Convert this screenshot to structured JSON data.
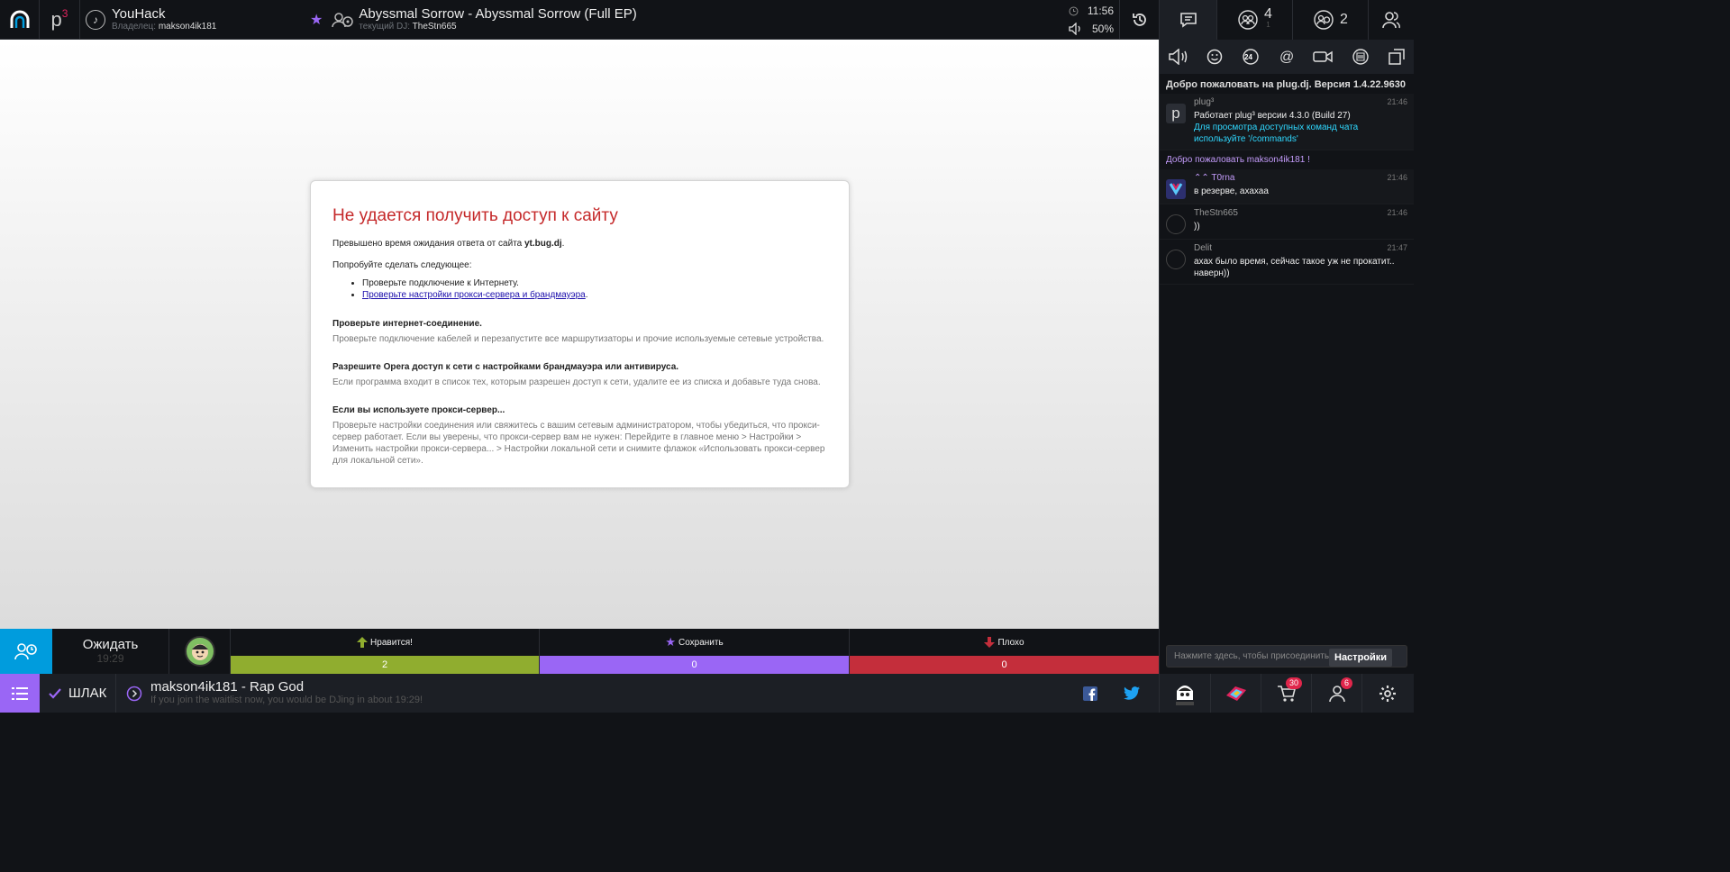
{
  "topbar": {
    "logo_sup": "3",
    "logo_p": "p",
    "room_name": "YouHack",
    "owner_label": "Владелец:",
    "owner_name": "makson4ik181",
    "song_title": "Abyssmal Sorrow - Abyssmal Sorrow (Full EP)",
    "dj_label": "текущий DJ:",
    "dj_name": "TheStn665",
    "time": "11:56",
    "volume": "50%"
  },
  "error_page": {
    "title": "Не удается получить доступ к сайту",
    "timeout_prefix": "Превышено время ожидания ответа от сайта ",
    "timeout_host": "yt.bug.dj",
    "timeout_suffix": ".",
    "try_label": "Попробуйте сделать следующее:",
    "suggestions": [
      "Проверьте подключение к Интернету.",
      "Проверьте настройки прокси-сервера и брандмауэра"
    ],
    "sections": [
      {
        "heading": "Проверьте интернет-соединение.",
        "text": "Проверьте подключение кабелей и перезапустите все маршрутизаторы и прочие используемые сетевые устройства."
      },
      {
        "heading": "Разрешите Opera доступ к сети с настройками брандмауэра или антивируса.",
        "text": "Если программа входит в список тех, которым разрешен доступ к сети, удалите ее из списка и добавьте туда снова."
      },
      {
        "heading": "Если вы используете прокси-сервер...",
        "text": "Проверьте настройки соединения или свяжитесь с вашим сетевым администратором, чтобы убедиться, что прокси-сервер работает. Если вы уверены, что прокси-сервер вам не нужен: Перейдите в главное меню > Настройки > Изменить настройки прокси-сервера... > Настройки локальной сети и снимите флажок «Использовать прокси-сервер для локальной сети»."
      }
    ]
  },
  "bottom": {
    "wait_label": "Ожидать",
    "wait_time": "19:29",
    "votes": [
      {
        "label": "Нравится!",
        "count": "2",
        "color": "#90ad2f",
        "icon": "arrow-up-icon"
      },
      {
        "label": "Сохранить",
        "count": "0",
        "color": "#9a66f5",
        "icon": "star-icon"
      },
      {
        "label": "Плохо",
        "count": "0",
        "color": "#c42e3b",
        "icon": "arrow-down-icon"
      }
    ]
  },
  "footer": {
    "playlist_name": "ШЛАК",
    "next_song": "makson4ik181 - Rap God",
    "next_hint": "If you join the waitlist now, you would be DJing in about 19:29!"
  },
  "sidebar": {
    "tabs": [
      {
        "name": "chat",
        "icon": "chat-icon",
        "count": ""
      },
      {
        "name": "audience",
        "icon": "audience-icon",
        "count": "4",
        "sub": "1"
      },
      {
        "name": "waitlist",
        "icon": "waitlist-icon",
        "count": "2"
      },
      {
        "name": "friends",
        "icon": "friends-icon",
        "count": ""
      }
    ],
    "welcome_system": "Добро пожаловать на plug.dj. Версия 1.4.22.9630",
    "messages": [
      {
        "user": "plug³",
        "time": "21:46",
        "lines": [
          "Работает plug³ версии 4.3.0 (Build 27)"
        ],
        "cyan": "Для просмотра доступных команд чата используйте '/commands'"
      },
      {
        "user": "T0rna",
        "time": "21:46",
        "lines": [
          "в резерве, ахахаа"
        ]
      },
      {
        "user": "TheStn665",
        "time": "21:46",
        "lines": [
          "))"
        ]
      },
      {
        "user": "Delit",
        "time": "21:47",
        "lines": [
          "ахах было время, сейчас такое уж не прокатит.. наверн))"
        ]
      }
    ],
    "welcome_user": "Добро пожаловать makson4ik181 !",
    "chat_placeholder": "Нажмите здесь, чтобы присоединиться к чату",
    "tooltip": "Настройки",
    "badges": {
      "shop": "30",
      "profile": "6"
    }
  },
  "colors": {
    "accent": "#009cdd",
    "purple": "#9a66f5",
    "bg": "#111317"
  }
}
